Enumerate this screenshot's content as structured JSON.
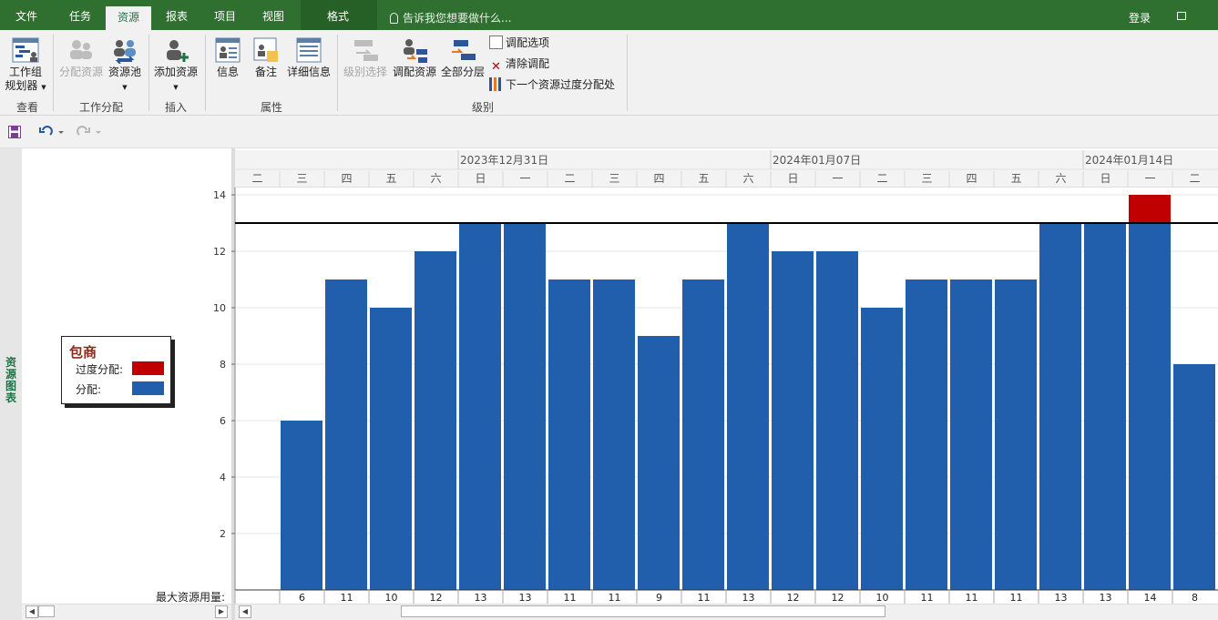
{
  "ribbon_tabs": [
    "文件",
    "任务",
    "资源",
    "报表",
    "项目",
    "视图",
    "格式"
  ],
  "active_tab": "资源",
  "tell_me": "告诉我您想要做什么...",
  "login": "登录",
  "ribbon": {
    "team_planner_1": "工作组",
    "team_planner_2": "规划器",
    "assign_resources": "分配资源",
    "resource_pool": "资源池",
    "add_resources": "添加资源",
    "information": "信息",
    "notes": "备注",
    "details": "详细信息",
    "level_selection": "级别选择",
    "level_resource": "调配资源",
    "level_all": "全部分层",
    "leveling_options": "调配选项",
    "clear_leveling": "清除调配",
    "next_overallocation": "下一个资源过度分配处",
    "groups": {
      "view": "查看",
      "assignments": "工作分配",
      "insert": "插入",
      "properties": "属性",
      "level": "级别"
    }
  },
  "side_label": "资源图表",
  "legend": {
    "title": "包商",
    "overallocated": "过度分配:",
    "allocated": "分配:"
  },
  "max_units_label": "最大资源用量:",
  "colors": {
    "allocated": "#215fac",
    "overallocated": "#c00000",
    "ribbon_green": "#2f7031"
  },
  "chart_data": {
    "type": "bar",
    "week_labels": [
      "2023年12月31日",
      "2024年01月07日",
      "2024年01月14日"
    ],
    "day_labels": [
      "二",
      "三",
      "四",
      "五",
      "六",
      "日",
      "一",
      "二",
      "三",
      "四",
      "五",
      "六",
      "日",
      "一",
      "二",
      "三",
      "四",
      "五",
      "六",
      "日",
      "一",
      "二"
    ],
    "allocated": [
      0,
      6,
      11,
      10,
      12,
      13,
      13,
      11,
      11,
      9,
      11,
      13,
      12,
      12,
      10,
      11,
      11,
      11,
      13,
      13,
      13,
      8
    ],
    "overallocated": [
      0,
      0,
      0,
      0,
      0,
      0,
      0,
      0,
      0,
      0,
      0,
      0,
      0,
      0,
      0,
      0,
      0,
      0,
      0,
      0,
      1,
      0
    ],
    "max_units_row": [
      "",
      "6",
      "11",
      "10",
      "12",
      "13",
      "13",
      "11",
      "11",
      "9",
      "11",
      "13",
      "12",
      "12",
      "10",
      "11",
      "11",
      "11",
      "13",
      "13",
      "14",
      "8"
    ],
    "max_availability": 13,
    "y_ticks": [
      "2",
      "4",
      "6",
      "8",
      "10",
      "12",
      "14"
    ],
    "ylim": [
      0,
      14
    ]
  }
}
